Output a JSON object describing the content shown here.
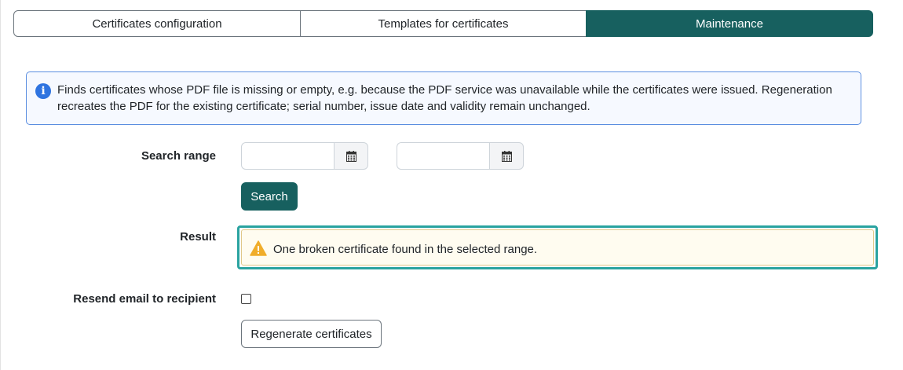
{
  "tabs": [
    {
      "label": "Certificates configuration",
      "active": false
    },
    {
      "label": "Templates for certificates",
      "active": false
    },
    {
      "label": "Maintenance",
      "active": true
    }
  ],
  "info": {
    "icon": "info-icon",
    "text": "Finds certificates whose PDF file is missing or empty, e.g. because the PDF service was unavailable while the certificates were issued. Regeneration recreates the PDF for the existing certificate; serial number, issue date and validity remain unchanged."
  },
  "search": {
    "label": "Search range",
    "from_value": "",
    "to_value": "",
    "button_label": "Search"
  },
  "result": {
    "label": "Result",
    "message": "One broken certificate found in the selected range."
  },
  "resend": {
    "label": "Resend email to recipient",
    "checked": false
  },
  "actions": {
    "regenerate_label": "Regenerate certificates"
  },
  "colors": {
    "primary": "#17605f",
    "info_border": "#5b8ee0",
    "info_icon": "#2f74e0",
    "warning": "#f0ad2a",
    "focus_ring": "#2aa3a0"
  }
}
